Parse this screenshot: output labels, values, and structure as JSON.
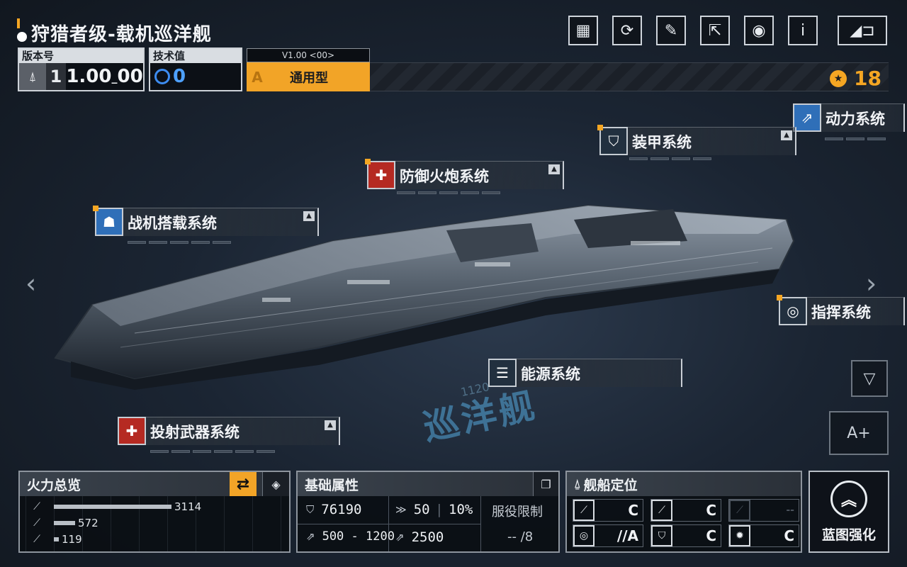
{
  "header": {
    "title": "狩猎者级-载机巡洋舰",
    "version_label": "版本号",
    "version_level": "1",
    "version_value": "1.00",
    "version_suffix": "00",
    "tech_label": "技术值",
    "tech_value": "0",
    "type_version": "V1.00 <00>",
    "type_grade": "A",
    "type_name": "通用型",
    "credits": "18"
  },
  "top_icons": [
    "blueprint-icon",
    "refresh-icon",
    "paint-icon",
    "share-icon",
    "view-icon",
    "info-icon",
    "back-icon"
  ],
  "modules": {
    "power": "动力系统",
    "armor": "装甲系统",
    "defense_gun": "防御火炮系统",
    "fighter": "战机搭载系统",
    "command": "指挥系统",
    "energy": "能源系统",
    "projectile": "投射武器系统"
  },
  "floor": {
    "text": "巡洋舰",
    "num": "1120"
  },
  "fire": {
    "title": "火力总览",
    "rows": [
      {
        "value": "3114",
        "ratio": 1.0
      },
      {
        "value": "572",
        "ratio": 0.18
      },
      {
        "value": "119",
        "ratio": 0.04
      }
    ]
  },
  "base": {
    "title": "基础属性",
    "hp": "76190",
    "armor": "50",
    "armor_pct": "10%",
    "speed": "500 - 1200",
    "warp": "2500",
    "service_label": "服役限制",
    "service_value": "-- /8"
  },
  "position": {
    "title": "舰船定位",
    "grades": [
      "C",
      "C",
      "--",
      "//A",
      "C",
      "C"
    ]
  },
  "upgrade": {
    "label": "蓝图强化"
  },
  "colors": {
    "accent": "#f2a427",
    "tech": "#4ea1ff"
  }
}
